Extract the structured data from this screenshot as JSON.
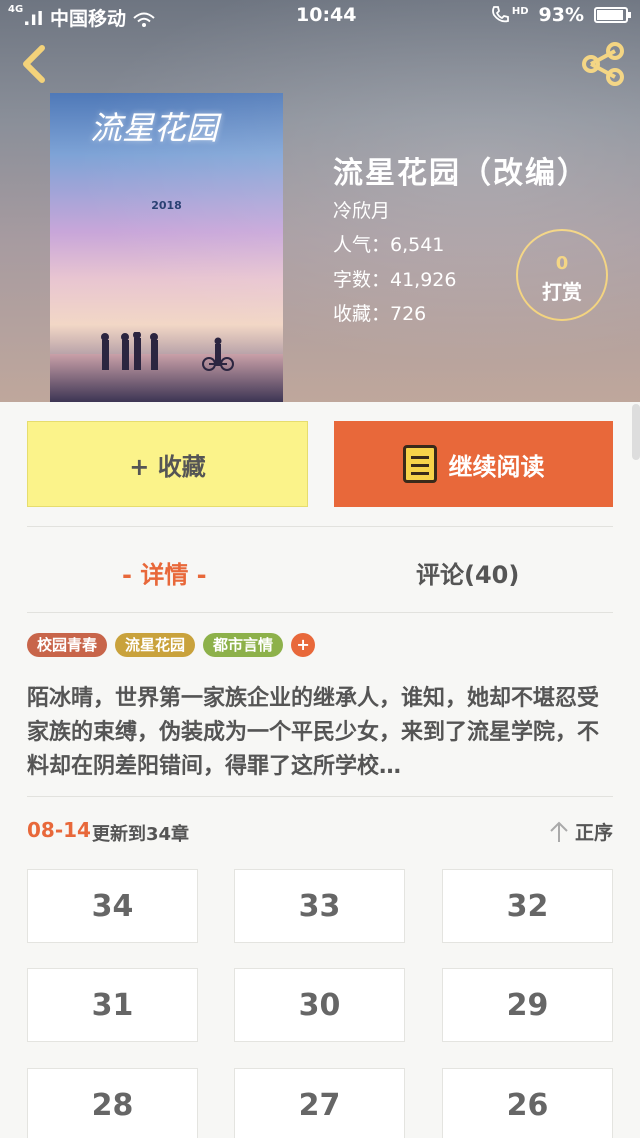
{
  "status_bar": {
    "carrier": "中国移动",
    "signal_label": "4G",
    "time": "10:44",
    "hd_label": "HD",
    "battery": "93%",
    "battery_level": 0.93
  },
  "header": {
    "back_icon": "chevron-left-icon",
    "share_icon": "share-icon"
  },
  "book": {
    "cover_title": "流星花园",
    "cover_year": "2018",
    "title": "流星花园（改编）",
    "author": "冷欣月",
    "popularity": "人气：6,541",
    "word_count": "字数：41,926",
    "favorites": "收藏：726"
  },
  "tip": {
    "count": "0",
    "label": "打赏"
  },
  "actions": {
    "favorite_label": "+ 收藏",
    "read_label": "继续阅读"
  },
  "tabs": [
    {
      "label": "- 详情 -",
      "active": true
    },
    {
      "label": "评论(40)",
      "active": false
    }
  ],
  "tags": [
    {
      "label": "校园青春",
      "color": "#c8654a"
    },
    {
      "label": "流星花园",
      "color": "#c9a23c"
    },
    {
      "label": "都市言情",
      "color": "#8db14a"
    }
  ],
  "description": "陌冰晴，世界第一家族企业的继承人，谁知，她却不堪忍受家族的束缚，伪装成为一个平民少女，来到了流星学院，不料却在阴差阳错间，得罪了这所学校…",
  "update": {
    "date": "08-14",
    "text": "更新到34章",
    "sort_label": "正序"
  },
  "chapters": [
    "34",
    "33",
    "32",
    "31",
    "30",
    "29",
    "28",
    "27",
    "26"
  ],
  "colors": {
    "accent": "#e8683a",
    "favorite_bg": "#fbf38a",
    "tip_ring": "#f3d27a"
  }
}
